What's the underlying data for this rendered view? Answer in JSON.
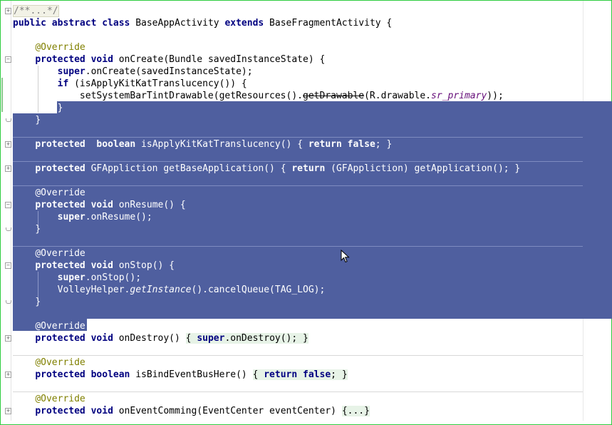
{
  "editor": {
    "lines": {
      "l1": "/**...*/",
      "l2_kw": "public abstract class",
      "l2_name": " BaseAppActivity ",
      "l2_ext": "extends",
      "l2_rest": " BaseFragmentActivity {",
      "ann": "@Override",
      "protected": "protected",
      "void": "void",
      "oncreate_rest": " onCreate(Bundle savedInstanceState) {",
      "super": "super",
      "super_oncreate_rest": ".onCreate(savedInstanceState);",
      "if": "if",
      "if_rest": " (isApplyKitKatTranslucency()) {",
      "settint_a": "setSystemBarTintDrawable(getResources().",
      "settint_dep": "getDrawable",
      "settint_b": "(R.drawable.",
      "settint_field": "sr_primary",
      "settint_c": "));",
      "brace_close": "}",
      "boolean": "boolean",
      "kitkat_rest": " isApplyKitKatTranslucency() { ",
      "return": "return",
      "false": "false",
      "semi_brace": "; }",
      "gf_type": " GFAppliction",
      "gf_rest": " getBaseApplication() { ",
      "gf_ret_rest": " (GFAppliction) getApplication(); }",
      "onresume_rest": " onResume() {",
      "super_onresume_rest": ".onResume();",
      "onstop_rest": " onStop() {",
      "super_onstop_rest": ".onStop();",
      "volley_a": "VolleyHelper.",
      "volley_b": "getInstance",
      "volley_c": "().cancelQueue(TAG_LOG);",
      "ondestroy_rest": " onDestroy() ",
      "ondestroy_body": "{ ",
      "ondestroy_super_rest": ".onDestroy(); }",
      "bindbus_rest": " isBindEventBusHere() ",
      "bindbus_body": "{ ",
      "bindbus_semi": "; }",
      "oneventcomming_rest": " onEventComming(EventCenter eventCenter) ",
      "oneventcomming_body": "{...}"
    }
  },
  "colors": {
    "selection": "#4f5f9f",
    "keyword": "#000080",
    "annotation": "#808000",
    "field": "#660e7a",
    "frame": "#2ecc40"
  },
  "icons": {
    "fold": "fold-marker-icon",
    "cursor": "mouse-pointer-icon"
  }
}
